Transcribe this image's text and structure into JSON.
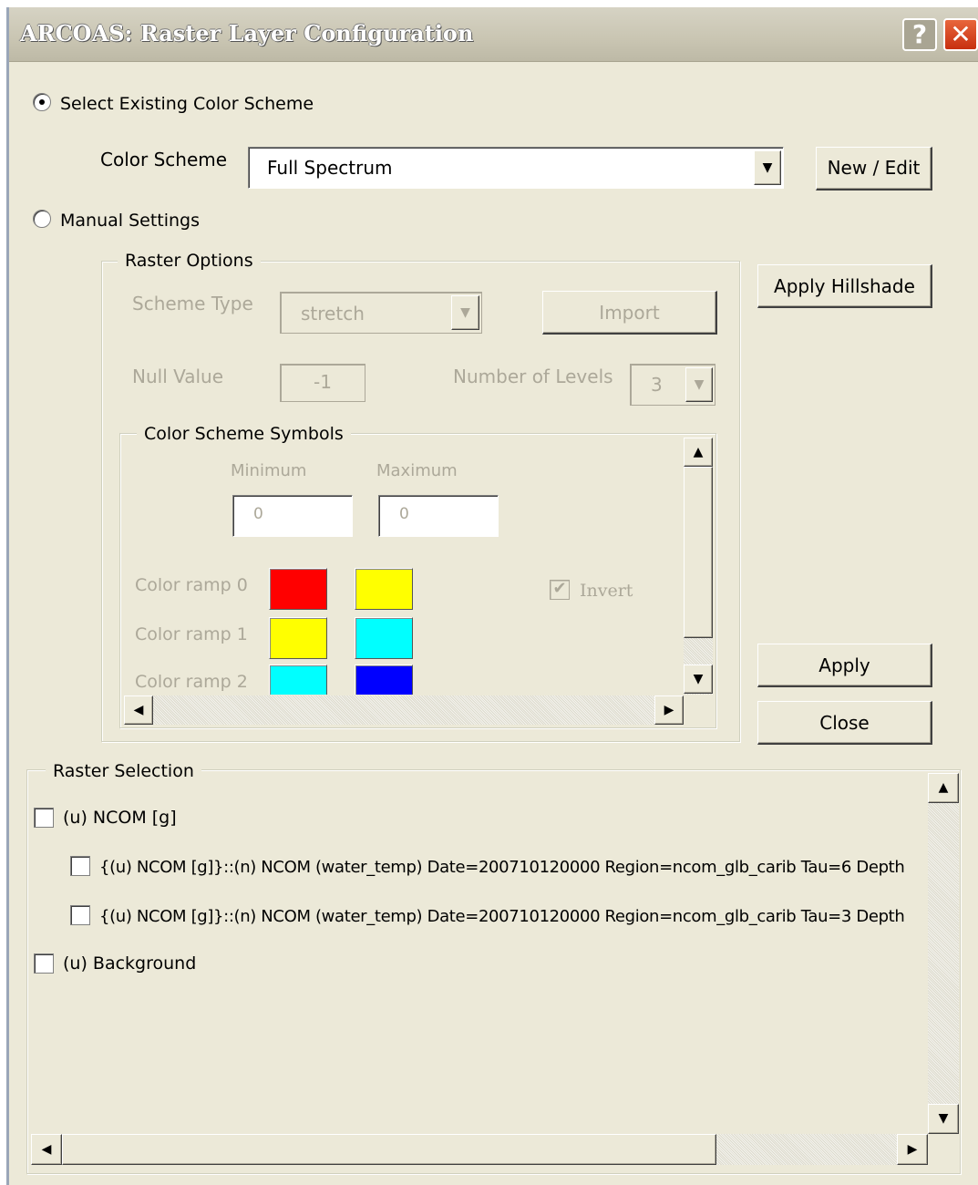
{
  "window": {
    "title": "ARCOAS:  Raster Layer Configuration",
    "help_glyph": "?",
    "close_glyph": "✕"
  },
  "color_scheme_mode": {
    "existing_label": "Select Existing Color Scheme",
    "existing_selected": true,
    "manual_label": "Manual Settings",
    "manual_selected": false
  },
  "color_scheme": {
    "label": "Color Scheme",
    "value": "Full Spectrum",
    "new_edit_label": "New / Edit"
  },
  "raster_options": {
    "title": "Raster Options",
    "scheme_type_label": "Scheme Type",
    "scheme_type_value": "stretch",
    "import_label": "Import",
    "null_value_label": "Null Value",
    "null_value": "-1",
    "levels_label": "Number of Levels",
    "levels_value": "3"
  },
  "symbols": {
    "title": "Color Scheme Symbols",
    "minimum_label": "Minimum",
    "maximum_label": "Maximum",
    "minimum_value": "0",
    "maximum_value": "0",
    "invert_label": "Invert",
    "invert_checked": true,
    "ramps": [
      {
        "label": "Color ramp 0",
        "from": "#ff0000",
        "to": "#ffff00"
      },
      {
        "label": "Color ramp 1",
        "from": "#ffff00",
        "to": "#00ffff"
      },
      {
        "label": "Color ramp 2",
        "from": "#00ffff",
        "to": "#0000ff"
      }
    ]
  },
  "actions": {
    "hillshade_label": "Apply Hillshade",
    "apply_label": "Apply",
    "close_label": "Close"
  },
  "raster_selection": {
    "title": "Raster Selection",
    "items": [
      {
        "label": "(u) NCOM [g]",
        "checked": false,
        "indent": 0
      },
      {
        "label": "{(u) NCOM [g]}::(n) NCOM (water_temp) Date=200710120000 Region=ncom_glb_carib Tau=6 Depth",
        "checked": false,
        "indent": 1
      },
      {
        "label": "{(u) NCOM [g]}::(n) NCOM (water_temp) Date=200710120000 Region=ncom_glb_carib Tau=3 Depth",
        "checked": false,
        "indent": 1
      },
      {
        "label": "(u) Background",
        "checked": false,
        "indent": 0
      }
    ]
  },
  "glyphs": {
    "combo_arrow": "▼",
    "scroll_up": "▲",
    "scroll_down": "▼",
    "scroll_left": "◀",
    "scroll_right": "▶",
    "check_mark": "✔"
  }
}
